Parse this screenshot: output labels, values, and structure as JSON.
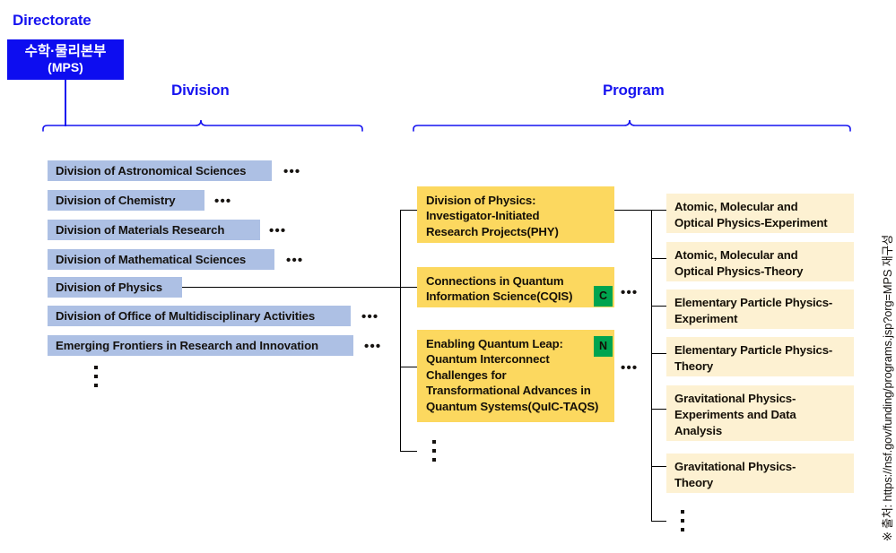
{
  "headers": {
    "directorate": "Directorate",
    "division": "Division",
    "program": "Program"
  },
  "root": {
    "name_ko": "수학·물리본부",
    "name_abbr": "(MPS)",
    "color": "#0d0df0",
    "text_color": "#ffffff"
  },
  "divisions": {
    "chip_color": "#adc0e4",
    "items": [
      {
        "label": "Division of Astronomical Sciences",
        "ellipsis": "•••",
        "selected": false
      },
      {
        "label": "Division of Chemistry",
        "ellipsis": "•••",
        "selected": false
      },
      {
        "label": "Division of Materials Research",
        "ellipsis": "•••",
        "selected": false
      },
      {
        "label": "Division of Mathematical Sciences",
        "ellipsis": "•••",
        "selected": false
      },
      {
        "label": "Division of Physics",
        "ellipsis": "",
        "selected": true
      },
      {
        "label": "Division of Office of Multidisciplinary Activities",
        "ellipsis": "•••",
        "selected": false
      },
      {
        "label": "Emerging Frontiers in Research and Innovation",
        "ellipsis": "•••",
        "selected": false
      }
    ],
    "more_indicator": "⋮"
  },
  "programs": {
    "box_color": "#fcd85f",
    "items": [
      {
        "label": "Division of Physics: Investigator-Initiated Research Projects(PHY)",
        "lines": [
          "Division of Physics:",
          "Investigator-Initiated",
          "Research Projects(PHY)"
        ],
        "badge": "",
        "ellipsis": ""
      },
      {
        "label": "Connections in Quantum Information Science(CQIS)",
        "lines": [
          "Connections in Quantum",
          "Information Science(CQIS)"
        ],
        "badge": "C",
        "ellipsis": "•••"
      },
      {
        "label": "Enabling Quantum Leap: Quantum Interconnect Challenges for Transformational Advances in Quantum Systems(QuIC-TAQS)",
        "lines": [
          "Enabling Quantum Leap:",
          "Quantum Interconnect",
          "Challenges for",
          "Transformational Advances in",
          "Quantum Systems(QuIC-TAQS)"
        ],
        "badge": "N",
        "ellipsis": "•••"
      }
    ],
    "badge_color": "#00a44f",
    "more_indicator": "⋮"
  },
  "topics": {
    "box_color": "#fdf1d2",
    "items": [
      {
        "label": "Atomic, Molecular and Optical Physics-Experiment",
        "lines": [
          "Atomic, Molecular and",
          "Optical Physics-Experiment"
        ]
      },
      {
        "label": "Atomic, Molecular and Optical Physics-Theory",
        "lines": [
          "Atomic, Molecular and",
          "Optical Physics-Theory"
        ]
      },
      {
        "label": "Elementary Particle Physics-Experiment",
        "lines": [
          "Elementary Particle Physics-",
          "Experiment"
        ]
      },
      {
        "label": "Elementary Particle Physics-Theory",
        "lines": [
          "Elementary Particle Physics-",
          "Theory"
        ]
      },
      {
        "label": "Gravitational Physics-Experiments and Data Analysis",
        "lines": [
          "Gravitational Physics-",
          "Experiments and Data",
          "Analysis"
        ]
      },
      {
        "label": "Gravitational Physics-Theory",
        "lines": [
          "Gravitational Physics-",
          "Theory"
        ]
      }
    ],
    "more_indicator": "⋮"
  },
  "source_note": "※ 출처: https://nsf.gov/funding/programs.jsp?org=MPS 재구성"
}
